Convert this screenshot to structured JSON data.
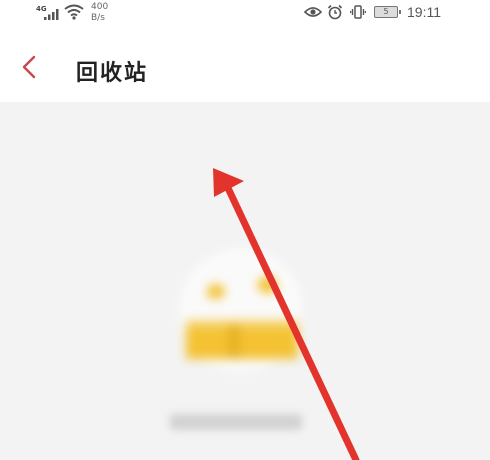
{
  "status_bar": {
    "network_label": "4G",
    "speed_value": "400",
    "speed_unit": "B/s",
    "battery_level": "5",
    "time": "19:11"
  },
  "header": {
    "title": "回收站"
  },
  "colors": {
    "accent": "#c9484f",
    "arrow": "#e2342c",
    "empty_icon": "#f4c233"
  }
}
